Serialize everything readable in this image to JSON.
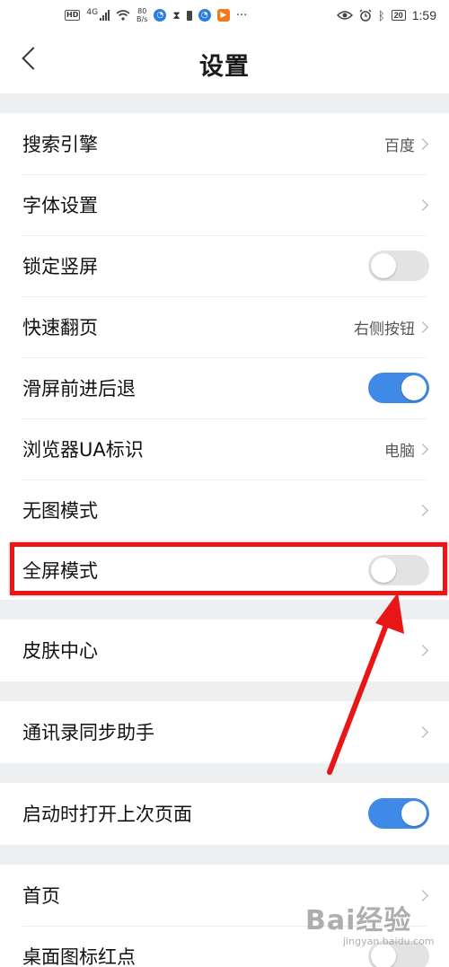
{
  "status_bar": {
    "hd": "HD",
    "network": "4G",
    "speed_value": "80",
    "speed_unit": "B/s",
    "more": "···",
    "battery": "20",
    "time": "1:59"
  },
  "header": {
    "title": "设置"
  },
  "settings": {
    "search_engine": {
      "label": "搜索引擎",
      "value": "百度"
    },
    "font": {
      "label": "字体设置"
    },
    "lock_portrait": {
      "label": "锁定竖屏",
      "on": false
    },
    "fast_page": {
      "label": "快速翻页",
      "value": "右侧按钮"
    },
    "swipe_nav": {
      "label": "滑屏前进后退",
      "on": true
    },
    "ua": {
      "label": "浏览器UA标识",
      "value": "电脑"
    },
    "no_image": {
      "label": "无图模式"
    },
    "fullscreen": {
      "label": "全屏模式",
      "on": false
    },
    "skin": {
      "label": "皮肤中心"
    },
    "contacts_sync": {
      "label": "通讯录同步助手"
    },
    "restore_last": {
      "label": "启动时打开上次页面",
      "on": true
    },
    "home": {
      "label": "首页"
    },
    "desktop_badge": {
      "label": "桌面图标红点",
      "on": false
    }
  },
  "watermark": {
    "main": "Bai经验",
    "sub": "jingyan.baidu.com"
  },
  "colors": {
    "toggle_on": "#3f8ae6",
    "toggle_off": "#e3e3e3",
    "highlight": "#e81616",
    "section_gap": "#eeeff1"
  }
}
